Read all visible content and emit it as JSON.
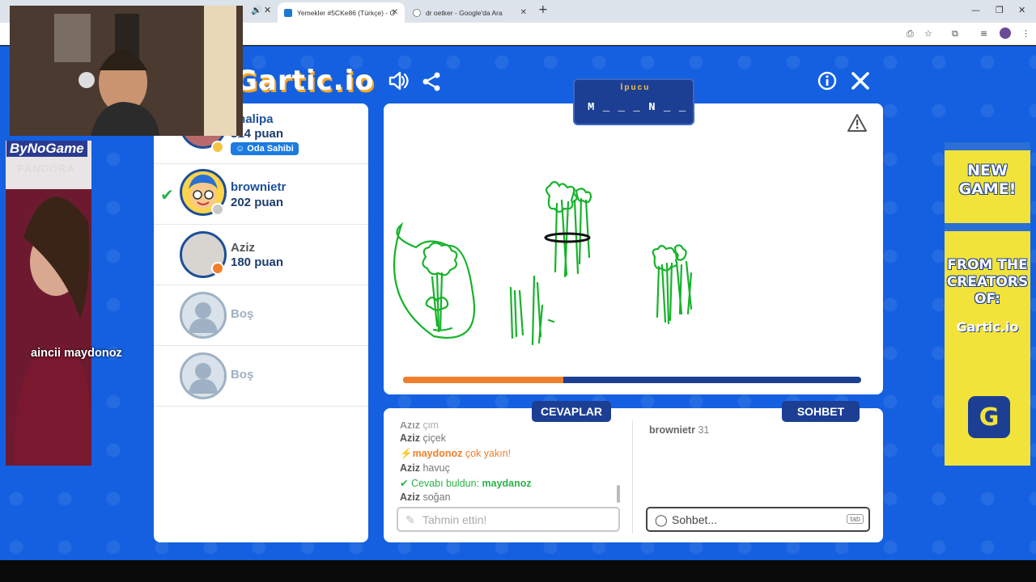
{
  "browser": {
    "tabs": [
      {
        "title": "Yemekler #5CKe86 (Türkçe) - G"
      },
      {
        "title": "dr oetker - Google'da Ara"
      }
    ]
  },
  "game": {
    "logo": "Gartic.io",
    "hint": {
      "title": "İpucu",
      "pattern": "M _ _ _ N _ _ _"
    },
    "progress_fraction": 0.35,
    "colors": {
      "background": "#1460e0",
      "panel_dark": "#1c3f94",
      "accent_orange": "#f07f2c",
      "correct_green": "#2ab24a",
      "drawing_green": "#16b32a"
    }
  },
  "players": [
    {
      "name": "uhalipa",
      "score": "314 puan",
      "badge": "Oda Sahibi",
      "status_color": "#f5c542"
    },
    {
      "name": "brownietr",
      "score": "202 puan",
      "status_color": "#c8c8c8",
      "guessed": true
    },
    {
      "name": "Aziz",
      "score": "180 puan",
      "status_color": "#f07f2c"
    },
    {
      "name": "Boş"
    },
    {
      "name": "Boş"
    }
  ],
  "answers": {
    "tab_label": "CEVAPLAR",
    "messages": [
      {
        "user": "Aziz",
        "text": "çim",
        "kind": "normal"
      },
      {
        "user": "Aziz",
        "text": "çiçek",
        "kind": "normal"
      },
      {
        "user": "maydonoz",
        "text": "çok yakın!",
        "kind": "close"
      },
      {
        "user": "Aziz",
        "text": "havuç",
        "kind": "normal"
      },
      {
        "prefix": "Cevabı buldun:",
        "user": "maydanoz",
        "kind": "found"
      },
      {
        "user": "Aziz",
        "text": "soğan",
        "kind": "normal"
      }
    ],
    "input_placeholder": "Tahmin ettin!"
  },
  "chat": {
    "tab_label": "SOHBET",
    "messages": [
      {
        "user": "brownietr",
        "text": "31"
      }
    ],
    "input_placeholder": "Sohbet...",
    "key_hint": "tab"
  },
  "ad": {
    "line1": "NEW GAME!",
    "line2": "FROM THE CREATORS OF:",
    "logo": "Gartic.io",
    "icon_letter": "G"
  },
  "stream_overlay": {
    "brand": "ByNoGame",
    "sub_brand": "PANDORA",
    "caption": "aincii  maydonoz"
  }
}
